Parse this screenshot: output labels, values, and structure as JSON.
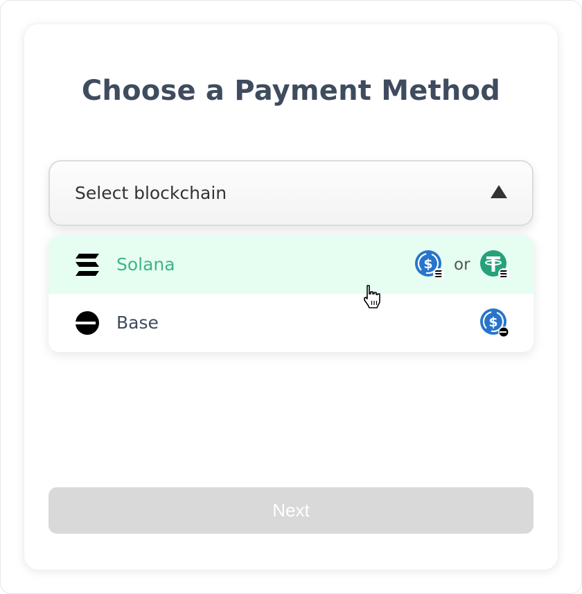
{
  "title": "Choose a Payment Method",
  "select": {
    "placeholder": "Select blockchain",
    "expanded": true,
    "caret_icon": "caret-up-icon"
  },
  "options": [
    {
      "label": "Solana",
      "chain_icon": "solana-icon",
      "highlighted": true,
      "tokens": [
        {
          "icon": "usdc-icon",
          "chain_badge": "solana-icon"
        },
        {
          "icon": "usdt-icon",
          "chain_badge": "solana-icon"
        }
      ],
      "separator": "or"
    },
    {
      "label": "Base",
      "chain_icon": "base-icon",
      "highlighted": false,
      "tokens": [
        {
          "icon": "usdc-icon",
          "chain_badge": "base-icon"
        }
      ]
    }
  ],
  "next_button": {
    "label": "Next",
    "disabled": true
  },
  "colors": {
    "title": "#3f4b5e",
    "highlight_bg": "#e6fdf2",
    "highlight_text": "#3fb48a",
    "usdc": "#2775ca",
    "usdt": "#26a17b",
    "button_disabled": "#d9d9d9"
  }
}
